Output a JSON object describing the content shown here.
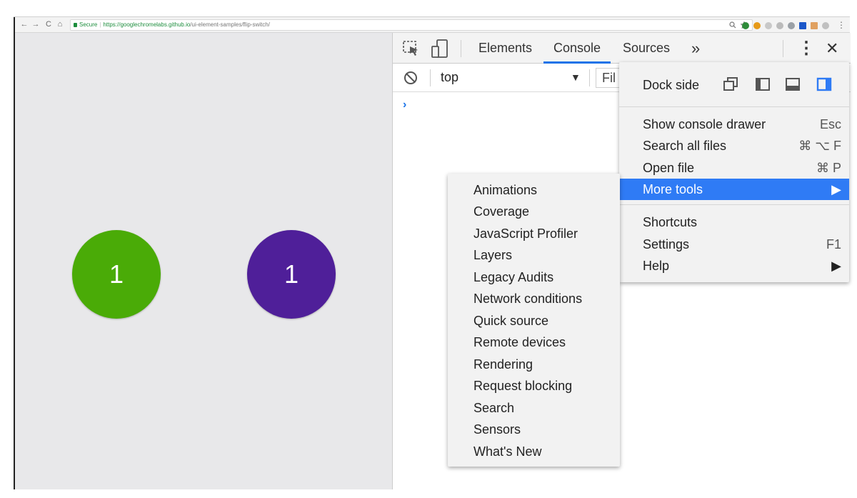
{
  "browser": {
    "nav": {
      "back": "←",
      "forward": "→",
      "reload": "C",
      "home": "⌂"
    },
    "secure_label": "Secure",
    "url_host": "https://googlechromelabs.github.io",
    "url_path": "/ui-element-samples/flip-switch/"
  },
  "page": {
    "switches": [
      {
        "value": "1",
        "color": "#4aab07"
      },
      {
        "value": "1",
        "color": "#4f1f99"
      }
    ]
  },
  "devtools": {
    "tabs": [
      "Elements",
      "Console",
      "Sources"
    ],
    "active_tab": "Console",
    "overflow_glyph": "»",
    "close_glyph": "✕",
    "kebab_glyph": "⋮",
    "console": {
      "context": "top",
      "filter_placeholder": "Fil",
      "prompt": "›"
    },
    "accent_color": "#1a73e8"
  },
  "main_menu": {
    "dock_side_label": "Dock side",
    "items": [
      {
        "label": "Show console drawer",
        "shortcut": "Esc"
      },
      {
        "label": "Search all files",
        "shortcut": "⌘ ⌥ F"
      },
      {
        "label": "Open file",
        "shortcut": "⌘ P"
      },
      {
        "label": "More tools",
        "shortcut": "▶"
      },
      {
        "label": "Shortcuts",
        "shortcut": ""
      },
      {
        "label": "Settings",
        "shortcut": "F1"
      },
      {
        "label": "Help",
        "shortcut": "▶"
      }
    ],
    "highlight_color": "#2f7bf5"
  },
  "more_tools_menu": {
    "items": [
      "Animations",
      "Coverage",
      "JavaScript Profiler",
      "Layers",
      "Legacy Audits",
      "Network conditions",
      "Quick source",
      "Remote devices",
      "Rendering",
      "Request blocking",
      "Search",
      "Sensors",
      "What's New"
    ]
  }
}
